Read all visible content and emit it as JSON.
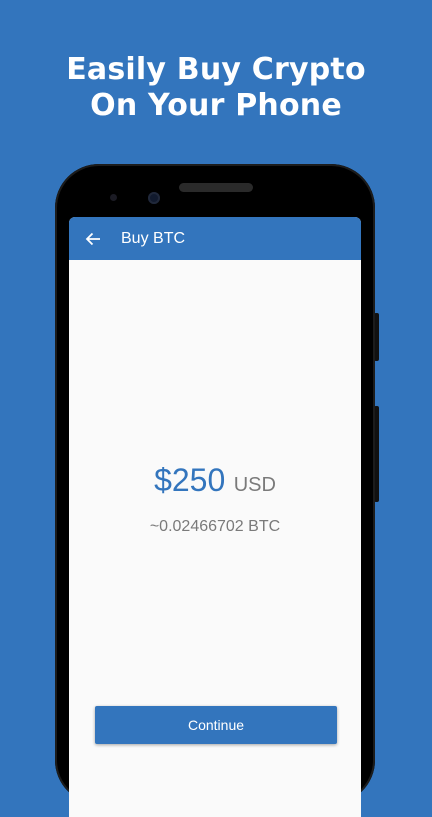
{
  "promo": {
    "headline_line1": "Easily Buy Crypto",
    "headline_line2": "On Your Phone"
  },
  "app": {
    "title": "Buy BTC",
    "back_icon": "arrow-back-icon",
    "accent_color": "#3375bd"
  },
  "purchase": {
    "amount": "$250",
    "currency": "USD",
    "crypto_estimate": "~0.02466702 BTC"
  },
  "actions": {
    "continue_label": "Continue"
  }
}
